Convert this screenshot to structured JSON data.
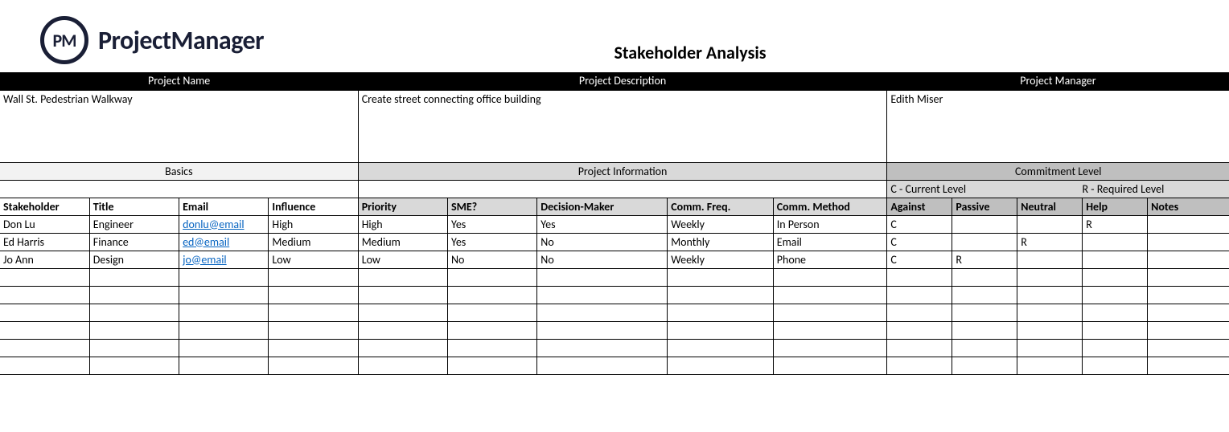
{
  "logo": {
    "badge": "PM",
    "brand": "ProjectManager"
  },
  "doc_title": "Stakeholder Analysis",
  "meta_headers": {
    "project_name": "Project Name",
    "project_description": "Project Description",
    "project_manager": "Project Manager"
  },
  "meta_values": {
    "project_name": "Wall St. Pedestrian Walkway",
    "project_description": "Create street connecting office building",
    "project_manager": "Edith Miser"
  },
  "sections": {
    "basics": "Basics",
    "project_info": "Project Information",
    "commitment": "Commitment Level"
  },
  "legend": {
    "current": "C - Current Level",
    "required": "R - Required Level"
  },
  "columns": {
    "stakeholder": "Stakeholder",
    "title": "Title",
    "email": "Email",
    "influence": "Influence",
    "priority": "Priority",
    "sme": "SME?",
    "decision": "Decision-Maker",
    "freq": "Comm. Freq.",
    "method": "Comm. Method",
    "against": "Against",
    "passive": "Passive",
    "neutral": "Neutral",
    "help": "Help",
    "notes": "Notes"
  },
  "rows": [
    {
      "stakeholder": "Don Lu",
      "title": "Engineer",
      "email": "donlu@email",
      "influence": "High",
      "priority": "High",
      "sme": "Yes",
      "decision": "Yes",
      "freq": "Weekly",
      "method": "In Person",
      "against": "C",
      "passive": "",
      "neutral": "",
      "help": "R",
      "notes": ""
    },
    {
      "stakeholder": "Ed Harris",
      "title": "Finance",
      "email": "ed@email",
      "influence": "Medium",
      "priority": "Medium",
      "sme": "Yes",
      "decision": "No",
      "freq": "Monthly",
      "method": "Email",
      "against": "C",
      "passive": "",
      "neutral": "R",
      "help": "",
      "notes": ""
    },
    {
      "stakeholder": "Jo Ann",
      "title": "Design",
      "email": "jo@email",
      "influence": "Low",
      "priority": "Low",
      "sme": "No",
      "decision": "No",
      "freq": "Weekly",
      "method": "Phone",
      "against": "C",
      "passive": "R",
      "neutral": "",
      "help": "",
      "notes": ""
    },
    {
      "stakeholder": "",
      "title": "",
      "email": "",
      "influence": "",
      "priority": "",
      "sme": "",
      "decision": "",
      "freq": "",
      "method": "",
      "against": "",
      "passive": "",
      "neutral": "",
      "help": "",
      "notes": ""
    },
    {
      "stakeholder": "",
      "title": "",
      "email": "",
      "influence": "",
      "priority": "",
      "sme": "",
      "decision": "",
      "freq": "",
      "method": "",
      "against": "",
      "passive": "",
      "neutral": "",
      "help": "",
      "notes": ""
    },
    {
      "stakeholder": "",
      "title": "",
      "email": "",
      "influence": "",
      "priority": "",
      "sme": "",
      "decision": "",
      "freq": "",
      "method": "",
      "against": "",
      "passive": "",
      "neutral": "",
      "help": "",
      "notes": ""
    },
    {
      "stakeholder": "",
      "title": "",
      "email": "",
      "influence": "",
      "priority": "",
      "sme": "",
      "decision": "",
      "freq": "",
      "method": "",
      "against": "",
      "passive": "",
      "neutral": "",
      "help": "",
      "notes": ""
    },
    {
      "stakeholder": "",
      "title": "",
      "email": "",
      "influence": "",
      "priority": "",
      "sme": "",
      "decision": "",
      "freq": "",
      "method": "",
      "against": "",
      "passive": "",
      "neutral": "",
      "help": "",
      "notes": ""
    },
    {
      "stakeholder": "",
      "title": "",
      "email": "",
      "influence": "",
      "priority": "",
      "sme": "",
      "decision": "",
      "freq": "",
      "method": "",
      "against": "",
      "passive": "",
      "neutral": "",
      "help": "",
      "notes": ""
    }
  ]
}
